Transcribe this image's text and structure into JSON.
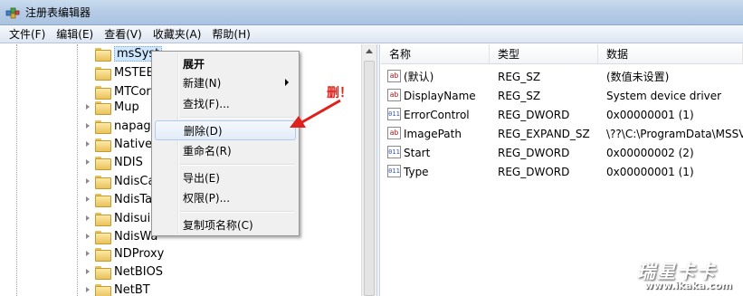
{
  "window": {
    "title": "注册表编辑器"
  },
  "menubar": [
    {
      "label": "文件(F)"
    },
    {
      "label": "编辑(E)"
    },
    {
      "label": "查看(V)"
    },
    {
      "label": "收藏夹(A)"
    },
    {
      "label": "帮助(H)"
    }
  ],
  "tree": [
    {
      "label": "msSyst",
      "expandable": false,
      "selected": true
    },
    {
      "label": "MSTEE",
      "expandable": false
    },
    {
      "label": "MTCor",
      "expandable": false
    },
    {
      "label": "Mup",
      "expandable": true
    },
    {
      "label": "napage",
      "expandable": true
    },
    {
      "label": "NativeW",
      "expandable": true
    },
    {
      "label": "NDIS",
      "expandable": true
    },
    {
      "label": "NdisCa",
      "expandable": true
    },
    {
      "label": "NdisTa",
      "expandable": true
    },
    {
      "label": "Ndisuio",
      "expandable": true
    },
    {
      "label": "NdisWa",
      "expandable": true
    },
    {
      "label": "NDProxy",
      "expandable": true
    },
    {
      "label": "NetBIOS",
      "expandable": true
    },
    {
      "label": "NetBT",
      "expandable": true
    }
  ],
  "columns": {
    "name": "名称",
    "type": "类型",
    "data": "数据"
  },
  "values": [
    {
      "name": "(默认)",
      "type": "REG_SZ",
      "data": "(数值未设置)",
      "icon": "ab"
    },
    {
      "name": "DisplayName",
      "type": "REG_SZ",
      "data": "System device driver",
      "icon": "ab"
    },
    {
      "name": "ErrorControl",
      "type": "REG_DWORD",
      "data": "0x00000001 (1)",
      "icon": "bin"
    },
    {
      "name": "ImagePath",
      "type": "REG_EXPAND_SZ",
      "data": "\\??\\C:\\ProgramData\\MSSV",
      "icon": "ab"
    },
    {
      "name": "Start",
      "type": "REG_DWORD",
      "data": "0x00000002 (2)",
      "icon": "bin"
    },
    {
      "name": "Type",
      "type": "REG_DWORD",
      "data": "0x00000001 (1)",
      "icon": "bin"
    }
  ],
  "context_menu": {
    "expand": "展开",
    "new": "新建(N)",
    "find": "查找(F)...",
    "delete": "删除(D)",
    "rename": "重命名(R)",
    "export": "导出(E)",
    "permissions": "权限(P)...",
    "copy_key_name": "复制项名称(C)"
  },
  "annotation": {
    "text": "删！",
    "color": "#e0201a"
  },
  "watermark": {
    "brand": "瑞星卡卡",
    "url": "www.ikaka.com"
  }
}
